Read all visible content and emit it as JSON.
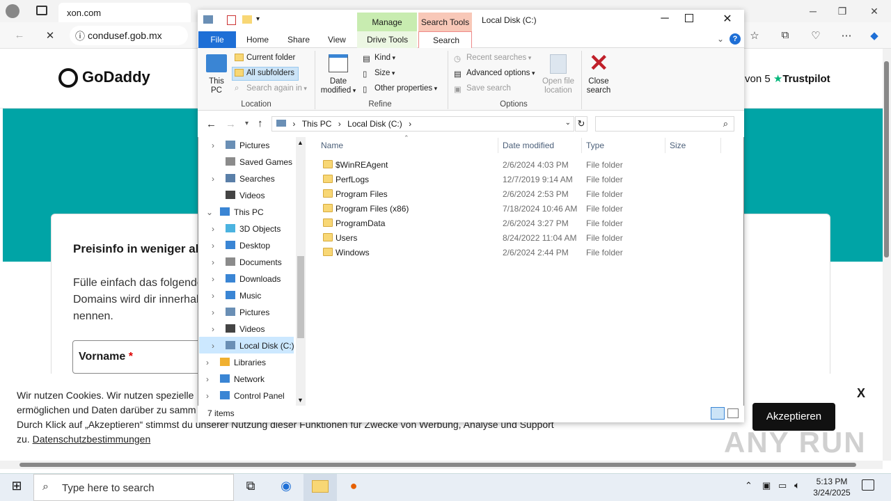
{
  "browser": {
    "tab_title": "xon.com",
    "address": "condusef.gob.mx"
  },
  "webpage": {
    "logo": "GoDaddy",
    "trust_prefix": "von 5",
    "trust_brand": "Trustpilot",
    "card_title": "Preisinfo in weniger als",
    "card_lines": [
      "Fülle einfach das folgende",
      "Domains wird dir innerhal",
      "nennen."
    ],
    "vorname_label": "Vorname",
    "required_mark": "*",
    "cookie_lines": [
      "Wir nutzen Cookies. Wir nutzen spezielle",
      "ermöglichen und Daten darüber zu samm",
      "Durch Klick auf „Akzeptieren“ stimmst du unserer Nutzung dieser Funktionen für Zwecke von Werbung, Analyse und Support",
      "zu."
    ],
    "privacy_link": "Datenschutzbestimmungen",
    "accept_label": "Akzeptieren",
    "close_label": "X",
    "watermark": "ANY RUN"
  },
  "explorer": {
    "title": "Local Disk (C:)",
    "tabs": {
      "file": "File",
      "home": "Home",
      "share": "Share",
      "view": "View",
      "drive_tools": "Drive Tools",
      "search": "Search"
    },
    "context_headers": {
      "manage": "Manage",
      "search_tools": "Search Tools"
    },
    "ribbon": {
      "this_pc": "This PC",
      "current_folder": "Current folder",
      "all_subfolders": "All subfolders",
      "search_again_in": "Search again in",
      "location_group": "Location",
      "date_modified": "Date modified",
      "kind": "Kind",
      "size": "Size",
      "other_properties": "Other properties",
      "refine_group": "Refine",
      "recent_searches": "Recent searches",
      "advanced_options": "Advanced options",
      "save_search": "Save search",
      "open_file_location": "Open file location",
      "options_group": "Options",
      "close_search": "Close search"
    },
    "breadcrumb": [
      "This PC",
      "Local Disk (C:)"
    ],
    "tree": [
      {
        "label": "Pictures",
        "indent": 1,
        "expand": true
      },
      {
        "label": "Saved Games",
        "indent": 1,
        "expand": false
      },
      {
        "label": "Searches",
        "indent": 1,
        "expand": true
      },
      {
        "label": "Videos",
        "indent": 1,
        "expand": false
      },
      {
        "label": "This PC",
        "indent": 0,
        "expand": true
      },
      {
        "label": "3D Objects",
        "indent": 1,
        "expand": true
      },
      {
        "label": "Desktop",
        "indent": 1,
        "expand": true
      },
      {
        "label": "Documents",
        "indent": 1,
        "expand": true
      },
      {
        "label": "Downloads",
        "indent": 1,
        "expand": true
      },
      {
        "label": "Music",
        "indent": 1,
        "expand": true
      },
      {
        "label": "Pictures",
        "indent": 1,
        "expand": true
      },
      {
        "label": "Videos",
        "indent": 1,
        "expand": true
      },
      {
        "label": "Local Disk (C:)",
        "indent": 1,
        "expand": true
      },
      {
        "label": "Libraries",
        "indent": 0,
        "expand": true
      },
      {
        "label": "Network",
        "indent": 0,
        "expand": true
      },
      {
        "label": "Control Panel",
        "indent": 0,
        "expand": true
      }
    ],
    "columns": {
      "name": "Name",
      "date": "Date modified",
      "type": "Type",
      "size": "Size"
    },
    "files": [
      {
        "name": "$WinREAgent",
        "date": "2/6/2024 4:03 PM",
        "type": "File folder"
      },
      {
        "name": "PerfLogs",
        "date": "12/7/2019 9:14 AM",
        "type": "File folder"
      },
      {
        "name": "Program Files",
        "date": "2/6/2024 2:53 PM",
        "type": "File folder"
      },
      {
        "name": "Program Files (x86)",
        "date": "7/18/2024 10:46 AM",
        "type": "File folder"
      },
      {
        "name": "ProgramData",
        "date": "2/6/2024 3:27 PM",
        "type": "File folder"
      },
      {
        "name": "Users",
        "date": "8/24/2022 11:04 AM",
        "type": "File folder"
      },
      {
        "name": "Windows",
        "date": "2/6/2024 2:44 PM",
        "type": "File folder"
      }
    ],
    "status": "7 items"
  },
  "taskbar": {
    "search_placeholder": "Type here to search",
    "time": "5:13 PM",
    "date": "3/24/2025"
  }
}
